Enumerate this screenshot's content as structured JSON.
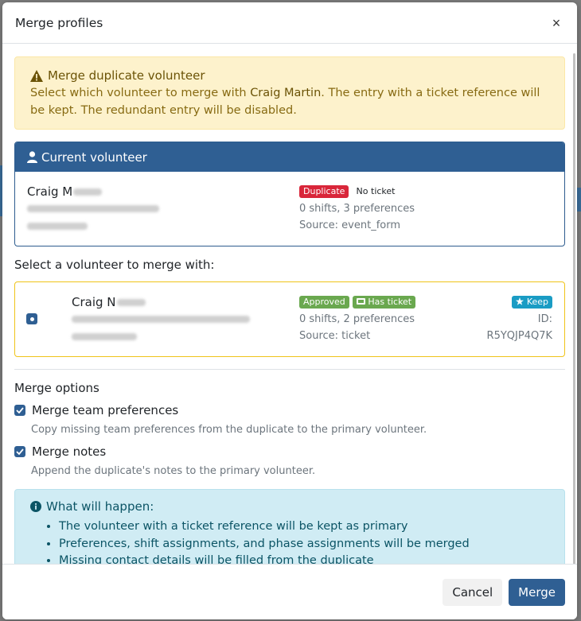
{
  "colors": {
    "primary": "#2f5f93",
    "warning_bg": "#fdf2cc",
    "info_bg": "#d0ecf4",
    "danger": "#d9263a",
    "success": "#6aa84f",
    "info": "#1a9cc4",
    "candidate_border": "#f0c419"
  },
  "modal": {
    "title": "Merge profiles",
    "close_label": "×"
  },
  "warning": {
    "icon": "warning-triangle-icon",
    "heading": "Merge duplicate volunteer",
    "text_before": "Select which volunteer to merge with ",
    "target_name": "Craig Martin",
    "text_after": ". The entry with a ticket reference will be kept. The redundant entry will be disabled."
  },
  "current": {
    "icon": "user-icon",
    "heading": "Current volunteer",
    "name_visible": "Craig M",
    "badge_status": "Duplicate",
    "badge_ticket": "No ticket",
    "summary": "0 shifts, 3 preferences",
    "source": "Source: event_form"
  },
  "select_label": "Select a volunteer to merge with:",
  "candidate": {
    "name_visible": "Craig N",
    "badge_status": "Approved",
    "badge_ticket": "Has ticket",
    "summary": "0 shifts, 2 preferences",
    "source": "Source: ticket",
    "keep_label": "Keep",
    "id_label": "ID:",
    "id_value": "R5YQJP4Q7K"
  },
  "options": {
    "title": "Merge options",
    "team": {
      "label": "Merge team preferences",
      "help": "Copy missing team preferences from the duplicate to the primary volunteer."
    },
    "notes": {
      "label": "Merge notes",
      "help": "Append the duplicate's notes to the primary volunteer."
    }
  },
  "info": {
    "icon": "info-circle-icon",
    "heading": "What will happen:",
    "items": [
      "The volunteer with a ticket reference will be kept as primary",
      "Preferences, shift assignments, and phase assignments will be merged",
      "Missing contact details will be filled from the duplicate"
    ]
  },
  "footer": {
    "cancel_label": "Cancel",
    "merge_label": "Merge"
  }
}
